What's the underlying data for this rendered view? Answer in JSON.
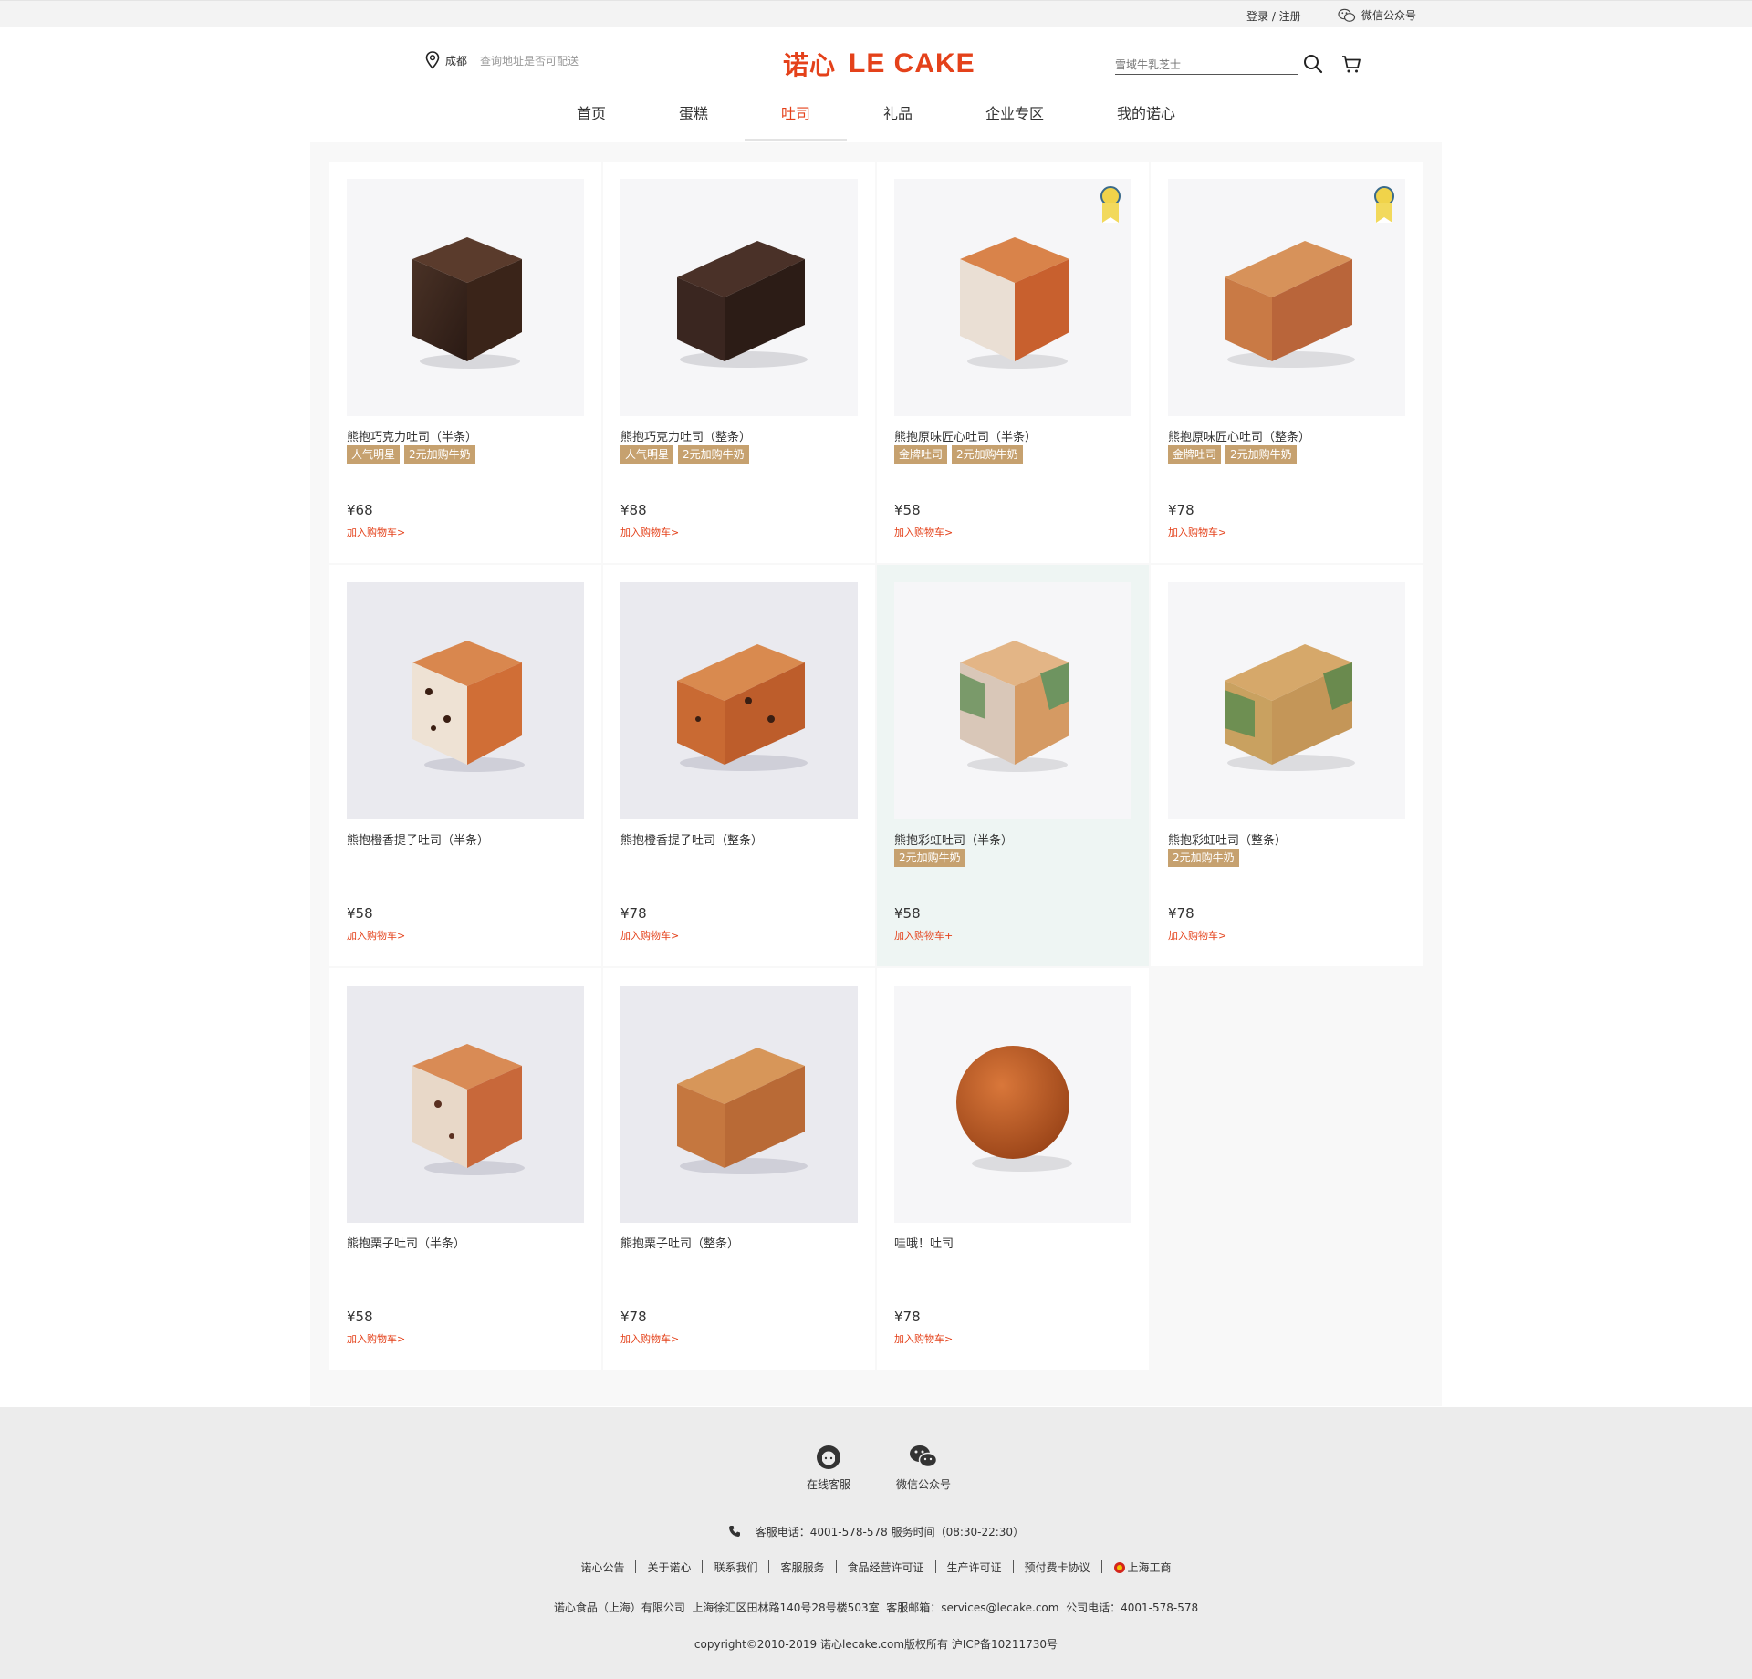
{
  "topbar": {
    "login": "登录 / 注册",
    "wechat": "微信公众号"
  },
  "header": {
    "city": "成都",
    "location_hint": "查询地址是否可配送",
    "logo_cn": "诺心",
    "logo_en": "LE CAKE",
    "search_placeholder": "雪域牛乳芝士",
    "accent_color": "#e4411a"
  },
  "nav": [
    "首页",
    "蛋糕",
    "吐司",
    "礼品",
    "企业专区",
    "我的诺心"
  ],
  "nav_active": "吐司",
  "products": [
    {
      "name": "熊抱巧克力吐司（半条）",
      "tags": [
        "人气明星",
        "2元加购牛奶"
      ],
      "price": "¥68",
      "add": "加入购物车>"
    },
    {
      "name": "熊抱巧克力吐司（整条）",
      "tags": [
        "人气明星",
        "2元加购牛奶"
      ],
      "price": "¥88",
      "add": "加入购物车>"
    },
    {
      "name": "熊抱原味匠心吐司（半条）",
      "tags": [
        "金牌吐司",
        "2元加购牛奶"
      ],
      "price": "¥58",
      "add": "加入购物车>"
    },
    {
      "name": "熊抱原味匠心吐司（整条）",
      "tags": [
        "金牌吐司",
        "2元加购牛奶"
      ],
      "price": "¥78",
      "add": "加入购物车>"
    },
    {
      "name": "熊抱橙香提子吐司（半条）",
      "tags": [],
      "price": "¥58",
      "add": "加入购物车>"
    },
    {
      "name": "熊抱橙香提子吐司（整条）",
      "tags": [],
      "price": "¥78",
      "add": "加入购物车>"
    },
    {
      "name": "熊抱彩虹吐司（半条）",
      "tags": [
        "2元加购牛奶"
      ],
      "price": "¥58",
      "add": "加入购物车+"
    },
    {
      "name": "熊抱彩虹吐司（整条）",
      "tags": [
        "2元加购牛奶"
      ],
      "price": "¥78",
      "add": "加入购物车>"
    },
    {
      "name": "熊抱栗子吐司（半条）",
      "tags": [],
      "price": "¥58",
      "add": "加入购物车>"
    },
    {
      "name": "熊抱栗子吐司（整条）",
      "tags": [],
      "price": "¥78",
      "add": "加入购物车>"
    },
    {
      "name": "哇哦！吐司",
      "tags": [],
      "price": "¥78",
      "add": "加入购物车>"
    }
  ],
  "footer": {
    "service_label": "在线客服",
    "wechat_label": "微信公众号",
    "phone": "客服电话：4001-578-578 服务时间（08:30-22:30）",
    "links": [
      "诺心公告",
      "关于诺心",
      "联系我们",
      "客服服务",
      "食品经营许可证",
      "生产许可证",
      "预付费卡协议",
      "上海工商"
    ],
    "company": "诺心食品（上海）有限公司  上海徐汇区田林路140号28号楼503室  客服邮箱：services@lecake.com  公司电话：4001-578-578",
    "copyright": "copyright©2010-2019 诺心lecake.com版权所有 沪ICP备10211730号"
  }
}
